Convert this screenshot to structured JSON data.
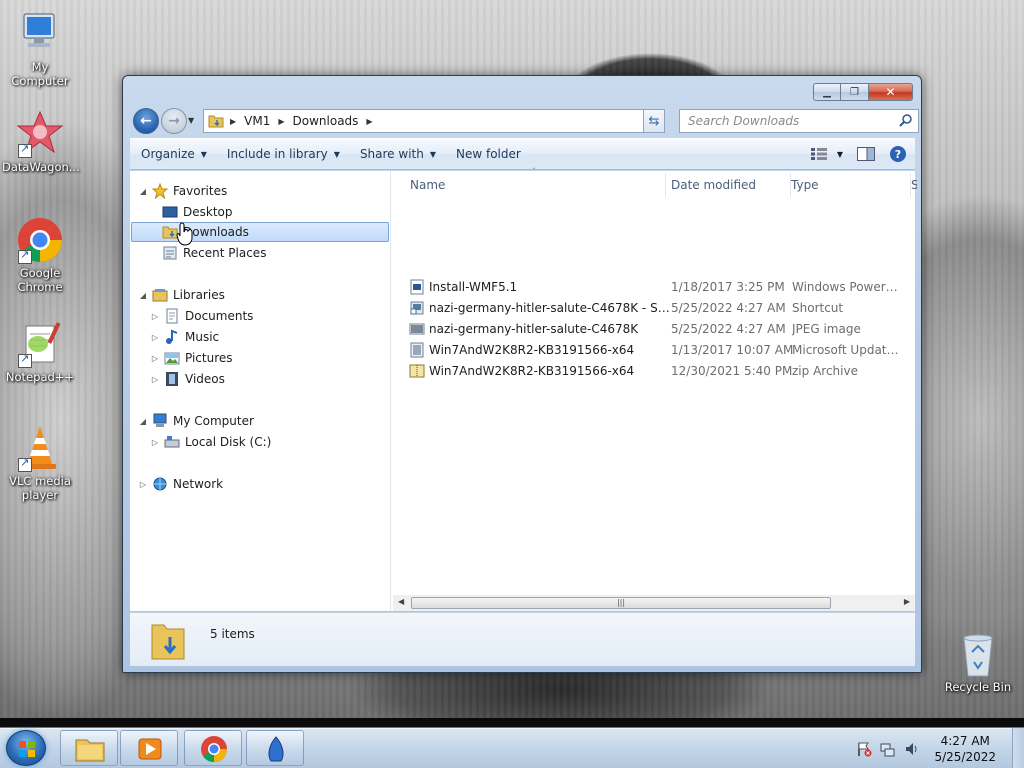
{
  "desktop": {
    "icons": [
      {
        "label": "My Computer"
      },
      {
        "label": "DataWagon..."
      },
      {
        "label": "Google Chrome"
      },
      {
        "label": "Notepad++"
      },
      {
        "label": "VLC media player"
      }
    ],
    "recycle_bin": "Recycle Bin"
  },
  "window": {
    "breadcrumb": [
      "VM1",
      "Downloads"
    ],
    "search_placeholder": "Search Downloads",
    "toolbar": {
      "organize": "Organize",
      "include_in_library": "Include in library",
      "share_with": "Share with",
      "new_folder": "New folder"
    },
    "nav": {
      "favorites": "Favorites",
      "desktop": "Desktop",
      "downloads": "Downloads",
      "recent_places": "Recent Places",
      "libraries": "Libraries",
      "documents": "Documents",
      "music": "Music",
      "pictures": "Pictures",
      "videos": "Videos",
      "my_computer": "My Computer",
      "local_disk": "Local Disk (C:)",
      "network": "Network"
    },
    "columns": {
      "name": "Name",
      "date_modified": "Date modified",
      "type": "Type",
      "size_partial": "S"
    },
    "files": [
      {
        "name": "Install-WMF5.1",
        "date": "1/18/2017 3:25 PM",
        "type": "Windows PowerS...",
        "icon": "powershell-script-icon"
      },
      {
        "name": "nazi-germany-hitler-salute-C4678K - Sho...",
        "date": "5/25/2022 4:27 AM",
        "type": "Shortcut",
        "icon": "shortcut-icon"
      },
      {
        "name": "nazi-germany-hitler-salute-C4678K",
        "date": "5/25/2022 4:27 AM",
        "type": "JPEG image",
        "icon": "jpeg-image-icon"
      },
      {
        "name": "Win7AndW2K8R2-KB3191566-x64",
        "date": "1/13/2017 10:07 AM",
        "type": "Microsoft Update ...",
        "icon": "update-package-icon"
      },
      {
        "name": "Win7AndW2K8R2-KB3191566-x64",
        "date": "12/30/2021 5:40 PM",
        "type": "zip Archive",
        "icon": "zip-archive-icon"
      }
    ],
    "status": {
      "item_count": "5 items"
    }
  },
  "taskbar": {
    "clock_time": "4:27 AM",
    "clock_date": "5/25/2022"
  },
  "colors": {
    "selection": "#c1dbfc",
    "window_chrome": "#b9cde6",
    "close_button": "#c0391f"
  }
}
